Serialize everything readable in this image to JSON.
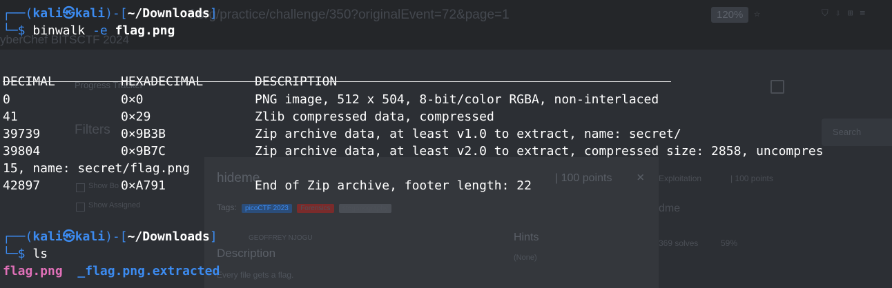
{
  "background": {
    "url_text": "f.org/practice/challenge/350?originalEvent=72&page=1",
    "zoom": "120%",
    "crumb": "yberChef   BITSCTF 2024",
    "progress_tracker": "Progress Tracker",
    "filters": "Filters",
    "search_label": "Search",
    "check_show_bookmarked": "Show Bo",
    "check_show_assigned": "Show Assigned",
    "modal": {
      "title": "hideme",
      "points": "| 100 points",
      "close": "×",
      "tags_label": "Tags:",
      "tags": [
        "picoCTF 2023",
        "Forensics",
        "steganography"
      ],
      "author": "GEOFFREY NJOGU",
      "hints_label": "Hints",
      "hints_value": "(None)",
      "description_label": "Description",
      "description_text": "Every file gets a flag."
    },
    "card": {
      "category": "Exploitation",
      "points": "| 100 points",
      "name": "dme",
      "solves": "369 solves",
      "rate": "59%",
      "points2": "| 100 points"
    }
  },
  "terminal": {
    "prompt1": {
      "top": "┌──(",
      "user": "kali",
      "at": "㉿",
      "host": "kali",
      "mid": ")-[",
      "cwd": "~/Downloads",
      "end": "]",
      "bottom": "└─$",
      "cmd": "binwalk",
      "flag_arg": "-e",
      "file_arg": "flag.png"
    },
    "headers": {
      "c1": "DECIMAL",
      "c2": "HEXADECIMAL",
      "c3": "DESCRIPTION"
    },
    "rows": [
      {
        "c1": "0",
        "c2": "0×0",
        "c3": "PNG image, 512 x 504, 8-bit/color RGBA, non-interlaced"
      },
      {
        "c1": "41",
        "c2": "0×29",
        "c3": "Zlib compressed data, compressed"
      },
      {
        "c1": "39739",
        "c2": "0×9B3B",
        "c3": "Zip archive data, at least v1.0 to extract, name: secret/"
      },
      {
        "c1": "39804",
        "c2": "0×9B7C",
        "c3": "Zip archive data, at least v2.0 to extract, compressed size: 2858, uncompres"
      },
      {
        "wrap": "15, name: secret/flag.png"
      },
      {
        "c1": "42897",
        "c2": "0×A791",
        "c3": "End of Zip archive, footer length: 22"
      }
    ],
    "prompt2": {
      "top": "┌──(",
      "user": "kali",
      "at": "㉿",
      "host": "kali",
      "mid": ")-[",
      "cwd": "~/Downloads",
      "end": "]",
      "bottom": "└─$",
      "cmd": "ls"
    },
    "ls_output": [
      "flag.png",
      "_flag.png.extracted"
    ]
  }
}
